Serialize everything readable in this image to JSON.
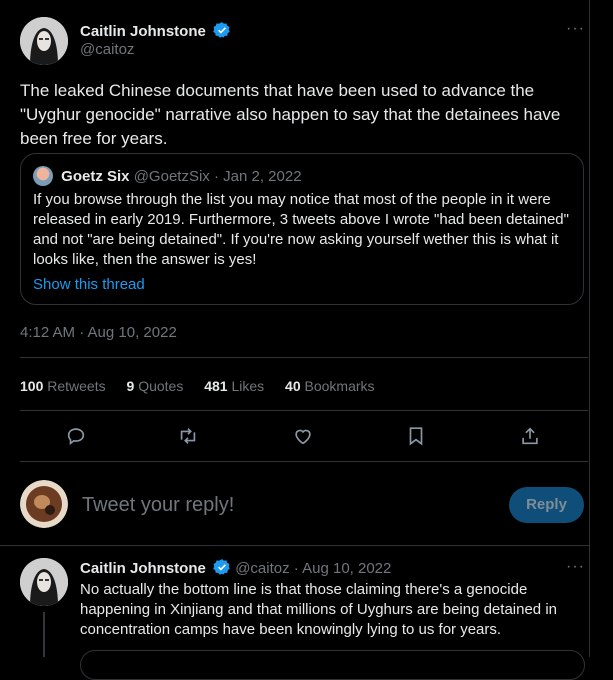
{
  "main_tweet": {
    "author_name": "Caitlin Johnstone",
    "author_handle": "@caitoz",
    "more_label": "···",
    "text": "The leaked Chinese documents that have been used to advance the \"Uyghur genocide\" narrative also happen to say that the detainees have been free for years.",
    "timestamp": "4:12 AM · Aug 10, 2022"
  },
  "quoted_tweet": {
    "author_name": "Goetz Six",
    "author_handle": "@GoetzSix",
    "date": "· Jan 2, 2022",
    "text": "If you browse through the list you may notice that most of the people in it were released in early 2019. Furthermore, 3 tweets above I wrote \"had been detained\" and not \"are being detained\". If you're now asking yourself wether this is what it looks like, then the answer is yes!",
    "show_thread": "Show this thread"
  },
  "stats": {
    "retweets_count": "100",
    "retweets_label": "Retweets",
    "quotes_count": "9",
    "quotes_label": "Quotes",
    "likes_count": "481",
    "likes_label": "Likes",
    "bookmarks_count": "40",
    "bookmarks_label": "Bookmarks"
  },
  "actions": [
    "reply-icon",
    "retweet-icon",
    "like-icon",
    "bookmark-icon",
    "share-icon"
  ],
  "reply_box": {
    "placeholder": "Tweet your reply!",
    "button_label": "Reply"
  },
  "reply_tweet": {
    "author_name": "Caitlin Johnstone",
    "author_handle": "@caitoz",
    "date": "· Aug 10, 2022",
    "more_label": "···",
    "text": "No actually the bottom line is that those claiming there's a genocide happening in Xinjiang and that millions of Uyghurs are being detained in concentration camps have been knowingly lying to us for years."
  },
  "colors": {
    "background": "#000000",
    "text": "#e7e9ea",
    "muted": "#71767b",
    "accent": "#1d9bf0",
    "border": "#2f3336"
  }
}
